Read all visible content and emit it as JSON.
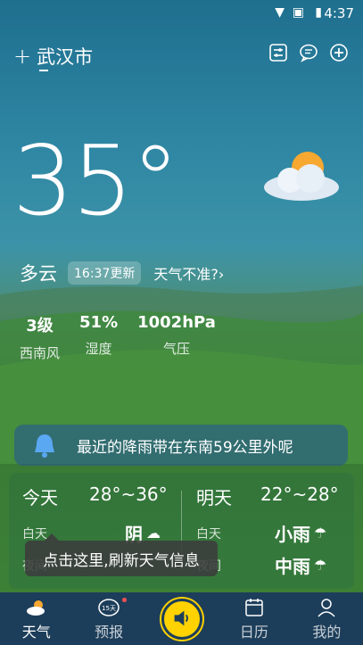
{
  "status_bar": {
    "time": "4:37"
  },
  "header": {
    "city": "武汉市"
  },
  "current": {
    "temperature": "35°",
    "condition": "多云",
    "updated": "16:37更新",
    "inaccurate_label": "天气不准?"
  },
  "metrics": [
    {
      "value": "3级",
      "label": "西南风"
    },
    {
      "value": "51%",
      "label": "湿度"
    },
    {
      "value": "1002hPa",
      "label": "气压"
    }
  ],
  "alert": {
    "text": "最近的降雨带在东南59公里外呢"
  },
  "forecast": {
    "today": {
      "label": "今天",
      "range": "28°~36°",
      "day_label": "白天",
      "day_cond": "阴",
      "night_label": "夜间"
    },
    "tomorrow": {
      "label": "明天",
      "range": "22°~28°",
      "day_label": "白天",
      "day_cond": "小雨",
      "night_label": "夜间",
      "night_cond": "中雨"
    }
  },
  "tooltip": {
    "text": "点击这里,刷新天气信息"
  },
  "nav": [
    {
      "label": "天气"
    },
    {
      "label": "预报"
    },
    {
      "label": ""
    },
    {
      "label": "日历"
    },
    {
      "label": "我的"
    }
  ]
}
